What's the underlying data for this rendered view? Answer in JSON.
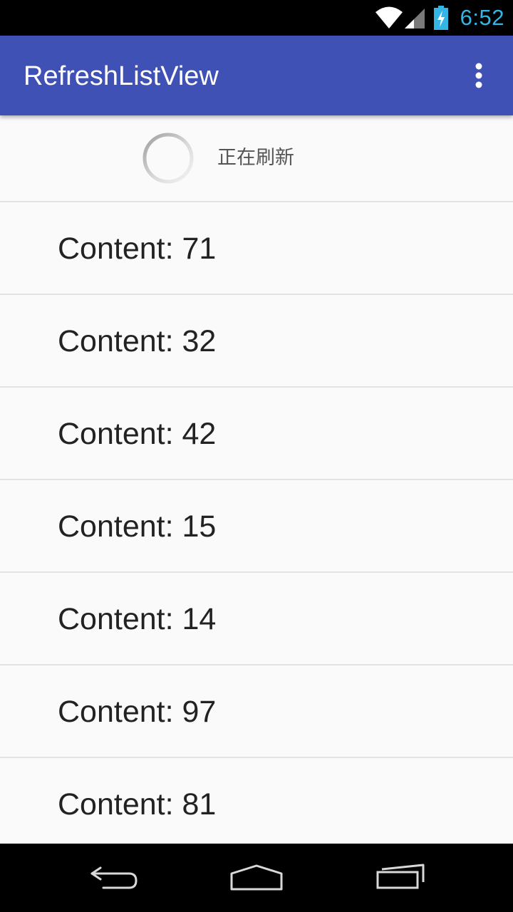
{
  "status_bar": {
    "time": "6:52",
    "icons": [
      "wifi-icon",
      "cell-signal-icon",
      "battery-charging-icon"
    ],
    "clock_color": "#33b5e5"
  },
  "app_bar": {
    "title": "RefreshListView",
    "background": "#3f51b5",
    "overflow_icon": "more-vert-icon"
  },
  "refresh_header": {
    "status_text": "正在刷新",
    "indicator_icon": "loading-spinner-icon"
  },
  "list": {
    "items": [
      {
        "label": "Content: 71"
      },
      {
        "label": "Content: 32"
      },
      {
        "label": "Content: 42"
      },
      {
        "label": "Content: 15"
      },
      {
        "label": "Content: 14"
      },
      {
        "label": "Content: 97"
      },
      {
        "label": "Content: 81"
      }
    ]
  },
  "nav_bar": {
    "buttons": [
      "back-icon",
      "home-icon",
      "recents-icon"
    ]
  }
}
